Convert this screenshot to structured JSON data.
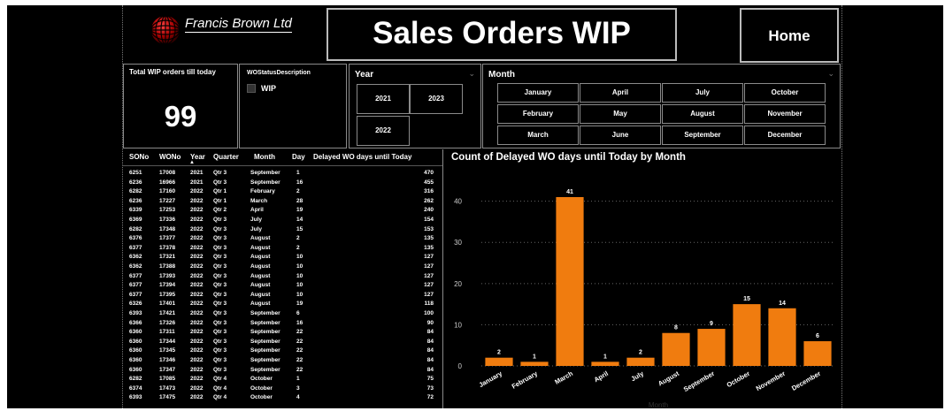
{
  "header": {
    "company": "Francis Brown Ltd",
    "title": "Sales Orders WIP",
    "home_label": "Home"
  },
  "kpi": {
    "label": "Total WIP orders till today",
    "value": "99"
  },
  "wo_status": {
    "label": "WOStatusDescription",
    "option": "WIP"
  },
  "year_slicer": {
    "label": "Year",
    "options": [
      "2021",
      "2023",
      "2022"
    ]
  },
  "month_slicer": {
    "label": "Month",
    "options": [
      "January",
      "April",
      "July",
      "October",
      "February",
      "May",
      "August",
      "November",
      "March",
      "June",
      "September",
      "December"
    ]
  },
  "table": {
    "columns": [
      "SONo",
      "WONo",
      "Year",
      "Quarter",
      "Month",
      "Day",
      "Delayed WO days until Today"
    ],
    "rows": [
      [
        "6251",
        "17008",
        "2021",
        "Qtr 3",
        "September",
        "1",
        "470"
      ],
      [
        "6236",
        "16966",
        "2021",
        "Qtr 3",
        "September",
        "16",
        "455"
      ],
      [
        "6282",
        "17160",
        "2022",
        "Qtr 1",
        "February",
        "2",
        "316"
      ],
      [
        "6236",
        "17227",
        "2022",
        "Qtr 1",
        "March",
        "28",
        "262"
      ],
      [
        "6339",
        "17253",
        "2022",
        "Qtr 2",
        "April",
        "19",
        "240"
      ],
      [
        "6369",
        "17336",
        "2022",
        "Qtr 3",
        "July",
        "14",
        "154"
      ],
      [
        "6282",
        "17348",
        "2022",
        "Qtr 3",
        "July",
        "15",
        "153"
      ],
      [
        "6376",
        "17377",
        "2022",
        "Qtr 3",
        "August",
        "2",
        "135"
      ],
      [
        "6377",
        "17378",
        "2022",
        "Qtr 3",
        "August",
        "2",
        "135"
      ],
      [
        "6362",
        "17321",
        "2022",
        "Qtr 3",
        "August",
        "10",
        "127"
      ],
      [
        "6362",
        "17388",
        "2022",
        "Qtr 3",
        "August",
        "10",
        "127"
      ],
      [
        "6377",
        "17393",
        "2022",
        "Qtr 3",
        "August",
        "10",
        "127"
      ],
      [
        "6377",
        "17394",
        "2022",
        "Qtr 3",
        "August",
        "10",
        "127"
      ],
      [
        "6377",
        "17395",
        "2022",
        "Qtr 3",
        "August",
        "10",
        "127"
      ],
      [
        "6326",
        "17401",
        "2022",
        "Qtr 3",
        "August",
        "19",
        "118"
      ],
      [
        "6393",
        "17421",
        "2022",
        "Qtr 3",
        "September",
        "6",
        "100"
      ],
      [
        "6366",
        "17326",
        "2022",
        "Qtr 3",
        "September",
        "16",
        "90"
      ],
      [
        "6360",
        "17311",
        "2022",
        "Qtr 3",
        "September",
        "22",
        "84"
      ],
      [
        "6360",
        "17344",
        "2022",
        "Qtr 3",
        "September",
        "22",
        "84"
      ],
      [
        "6360",
        "17345",
        "2022",
        "Qtr 3",
        "September",
        "22",
        "84"
      ],
      [
        "6360",
        "17346",
        "2022",
        "Qtr 3",
        "September",
        "22",
        "84"
      ],
      [
        "6360",
        "17347",
        "2022",
        "Qtr 3",
        "September",
        "22",
        "84"
      ],
      [
        "6282",
        "17085",
        "2022",
        "Qtr 4",
        "October",
        "1",
        "75"
      ],
      [
        "6374",
        "17473",
        "2022",
        "Qtr 4",
        "October",
        "3",
        "73"
      ],
      [
        "6393",
        "17475",
        "2022",
        "Qtr 4",
        "October",
        "4",
        "72"
      ]
    ]
  },
  "chart_data": {
    "type": "bar",
    "title": "Count of Delayed WO days until Today by Month",
    "xlabel": "Month",
    "ylabel": "",
    "categories": [
      "January",
      "February",
      "March",
      "April",
      "July",
      "August",
      "September",
      "October",
      "November",
      "December"
    ],
    "values": [
      2,
      1,
      41,
      1,
      2,
      8,
      9,
      15,
      14,
      6
    ],
    "ylim": [
      0,
      44
    ],
    "yticks": [
      0,
      10,
      20,
      30,
      40
    ],
    "bar_color": "#f07c0f",
    "grid": true
  },
  "colors": {
    "background": "#000000",
    "text": "#ffffff",
    "accent": "#f07c0f",
    "border": "#8a8a8a"
  }
}
